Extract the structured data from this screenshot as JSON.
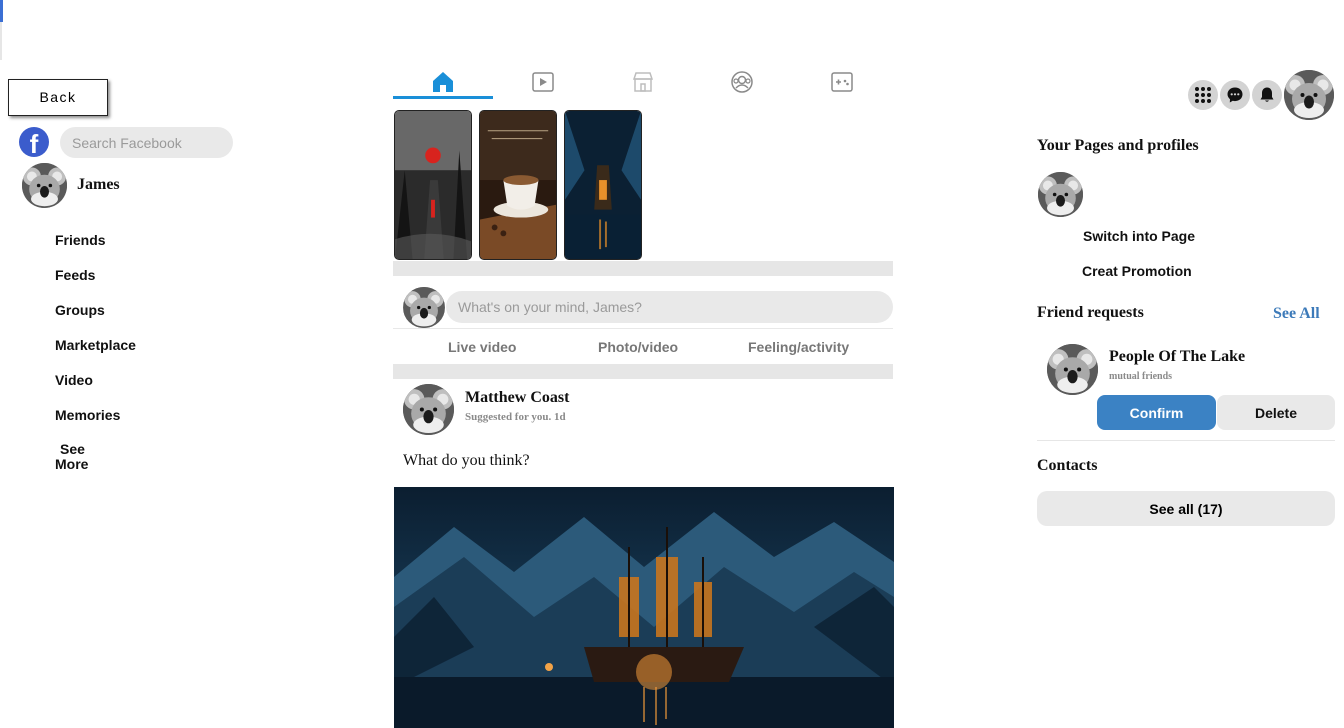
{
  "back_label": "Back",
  "search": {
    "placeholder": "Search Facebook"
  },
  "profile": {
    "name": "James"
  },
  "sidebar": {
    "items": [
      {
        "label": "Friends"
      },
      {
        "label": "Feeds"
      },
      {
        "label": "Groups"
      },
      {
        "label": "Marketplace"
      },
      {
        "label": "Video"
      },
      {
        "label": "Memories"
      }
    ],
    "see_more": [
      "See",
      "More"
    ]
  },
  "tabs": [
    {
      "name": "home-icon",
      "active": true
    },
    {
      "name": "video-icon"
    },
    {
      "name": "marketplace-icon"
    },
    {
      "name": "groups-icon"
    },
    {
      "name": "gaming-icon"
    }
  ],
  "composer": {
    "placeholder": "What's on your mind, James?",
    "actions": [
      "Live video",
      "Photo/video",
      "Feeling/activity"
    ]
  },
  "post": {
    "author": "Matthew Coast",
    "meta": "Suggested for you. 1d",
    "text": "What do you think?"
  },
  "right": {
    "icons": [
      "menu-grid-icon",
      "messenger-icon",
      "bell-icon"
    ],
    "pages_title": "Your Pages and profiles",
    "switch_label": "Switch into Page",
    "promo_label": "Creat Promotion",
    "requests_title": "Friend requests",
    "see_all_label": "See All",
    "request": {
      "name": "People Of The Lake",
      "meta": "mutual friends",
      "confirm": "Confirm",
      "delete": "Delete"
    },
    "contacts_title": "Contacts",
    "contacts_button": "See all (17)"
  },
  "colors": {
    "accent": "#1a8fd8",
    "confirm": "#3b82c4",
    "link": "#3c7ab9",
    "fb_blue": "#3b5ccc"
  }
}
